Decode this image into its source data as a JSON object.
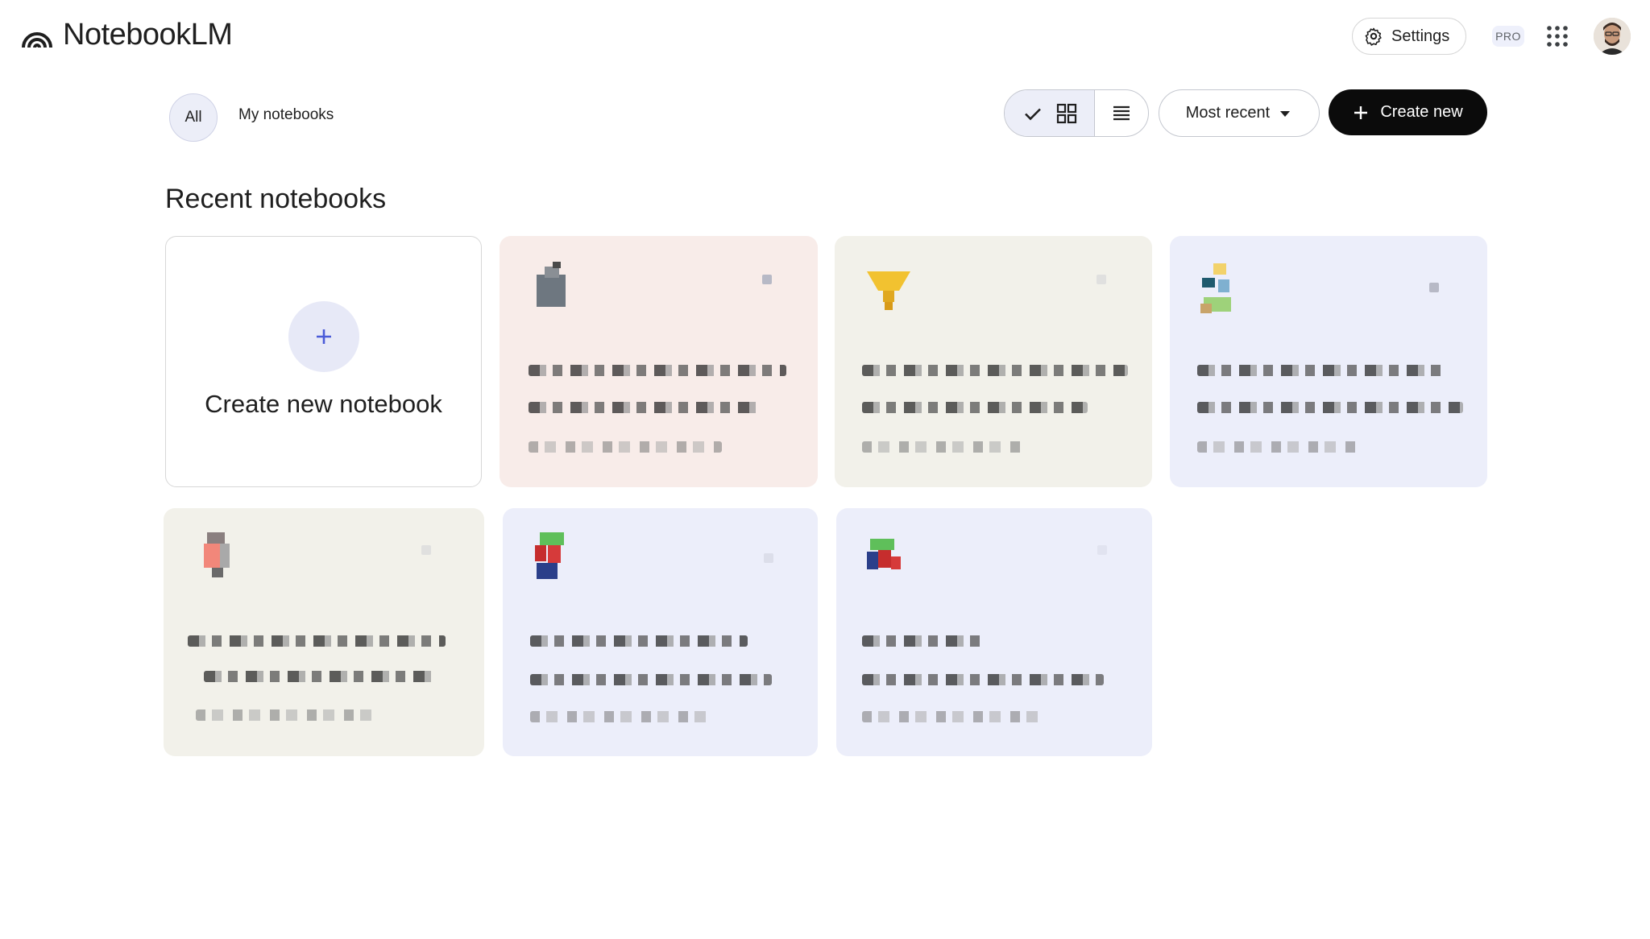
{
  "app": {
    "name": "NotebookLM"
  },
  "header": {
    "settings_label": "Settings",
    "pro_badge": "PRO"
  },
  "filters": {
    "all_label": "All",
    "mine_label": "My notebooks"
  },
  "toolbar": {
    "sort_label": "Most recent",
    "create_label": "Create new"
  },
  "section": {
    "title": "Recent notebooks"
  },
  "create_card": {
    "label": "Create new notebook"
  },
  "notebooks": [
    {
      "theme": "pink",
      "color": "#f8ece9",
      "icon": "notebook-emoji-icon"
    },
    {
      "theme": "beige",
      "color": "#f2f1ea",
      "icon": "notebook-emoji-icon"
    },
    {
      "theme": "lavender",
      "color": "#eceefa",
      "icon": "notebook-emoji-icon"
    },
    {
      "theme": "beige",
      "color": "#f2f1ea",
      "icon": "notebook-emoji-icon"
    },
    {
      "theme": "lavender",
      "color": "#eceefa",
      "icon": "notebook-emoji-icon"
    },
    {
      "theme": "lavender",
      "color": "#eceefa",
      "icon": "notebook-emoji-icon"
    }
  ],
  "colors": {
    "accent": "#0b0b0b",
    "chip_bg": "#eceef8",
    "plus_icon": "#4a5bd8"
  }
}
